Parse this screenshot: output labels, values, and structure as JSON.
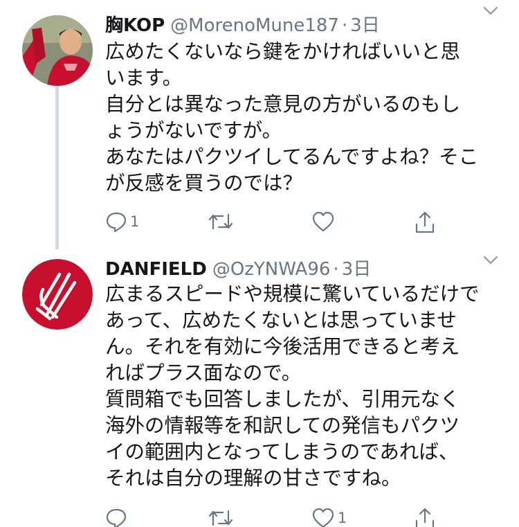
{
  "tweets": [
    {
      "display_name": "胸KOP",
      "handle": "@MorenoMune187",
      "separator": "·",
      "time": "3日",
      "avatar": "liverpool-player-photo",
      "lines": [
        "広めたくないなら鍵をかければいいと思",
        "います。",
        "自分とは異なった意見の方がいるのもし",
        "ょうがないですが。",
        "あなたはパクツイしてるんですよね？そこ",
        "が反感を買うのでは？"
      ],
      "reply_count": "1",
      "retweet_count": "",
      "like_count": "",
      "icons": {
        "reply": "reply-icon",
        "retweet": "retweet-icon",
        "like": "heart-icon",
        "share": "share-icon",
        "menu": "chevron-down-icon"
      }
    },
    {
      "display_name": "DANFIELD",
      "handle": "@OzYNWA96",
      "separator": "·",
      "time": "3日",
      "avatar": "liverpool-flame-logo",
      "lines": [
        "広まるスピードや規模に驚いているだけで",
        "あって、広めたくないとは思っていませ",
        "ん。それを有効に今後活用できると考え",
        "ればプラス面なので。",
        "質問箱でも回答しましたが、引用元なく",
        "海外の情報等を和訳しての発信もパクツ",
        "イの範囲内となってしまうのであれば、",
        "それは自分の理解の甘さですね。"
      ],
      "reply_count": "",
      "retweet_count": "",
      "like_count": "1",
      "icons": {
        "reply": "reply-icon",
        "retweet": "retweet-icon",
        "like": "heart-icon",
        "share": "share-icon",
        "menu": "chevron-down-icon"
      }
    }
  ],
  "colors": {
    "text": "#14171a",
    "secondary": "#657786",
    "thread_line": "#cfd9de",
    "logo_red": "#c8102e"
  }
}
